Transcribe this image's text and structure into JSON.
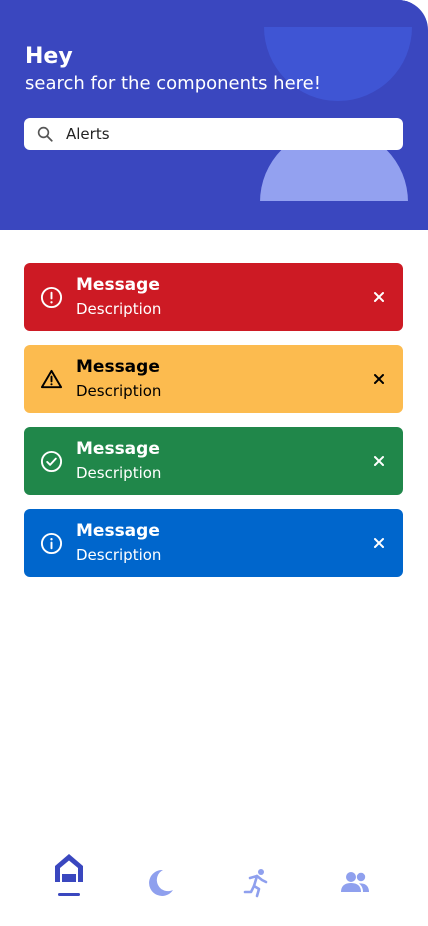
{
  "header": {
    "greeting": "Hey",
    "subtitle": "search for the components here!",
    "background": "#3a47bf"
  },
  "search": {
    "icon": "search-icon",
    "value": "Alerts",
    "placeholder": ""
  },
  "alerts": [
    {
      "type": "error",
      "title": "Message",
      "description": "Description",
      "icon": "alert-circle-icon",
      "background": "#cd1a24",
      "color": "#ffffff"
    },
    {
      "type": "warning",
      "title": "Message",
      "description": "Description",
      "icon": "warning-triangle-icon",
      "background": "#fcbb4f",
      "color": "#000000"
    },
    {
      "type": "success",
      "title": "Message",
      "description": "Description",
      "icon": "check-circle-icon",
      "background": "#20874a",
      "color": "#ffffff"
    },
    {
      "type": "info",
      "title": "Message",
      "description": "Description",
      "icon": "info-circle-icon",
      "background": "#0066cc",
      "color": "#ffffff"
    }
  ],
  "nav": {
    "items": [
      {
        "name": "home",
        "icon": "home-icon",
        "active": true
      },
      {
        "name": "sleep",
        "icon": "moon-icon",
        "active": false
      },
      {
        "name": "activity",
        "icon": "running-icon",
        "active": false
      },
      {
        "name": "people",
        "icon": "people-icon",
        "active": false
      }
    ],
    "active_color": "#3a47bf",
    "inactive_color": "#8fa0ee"
  }
}
